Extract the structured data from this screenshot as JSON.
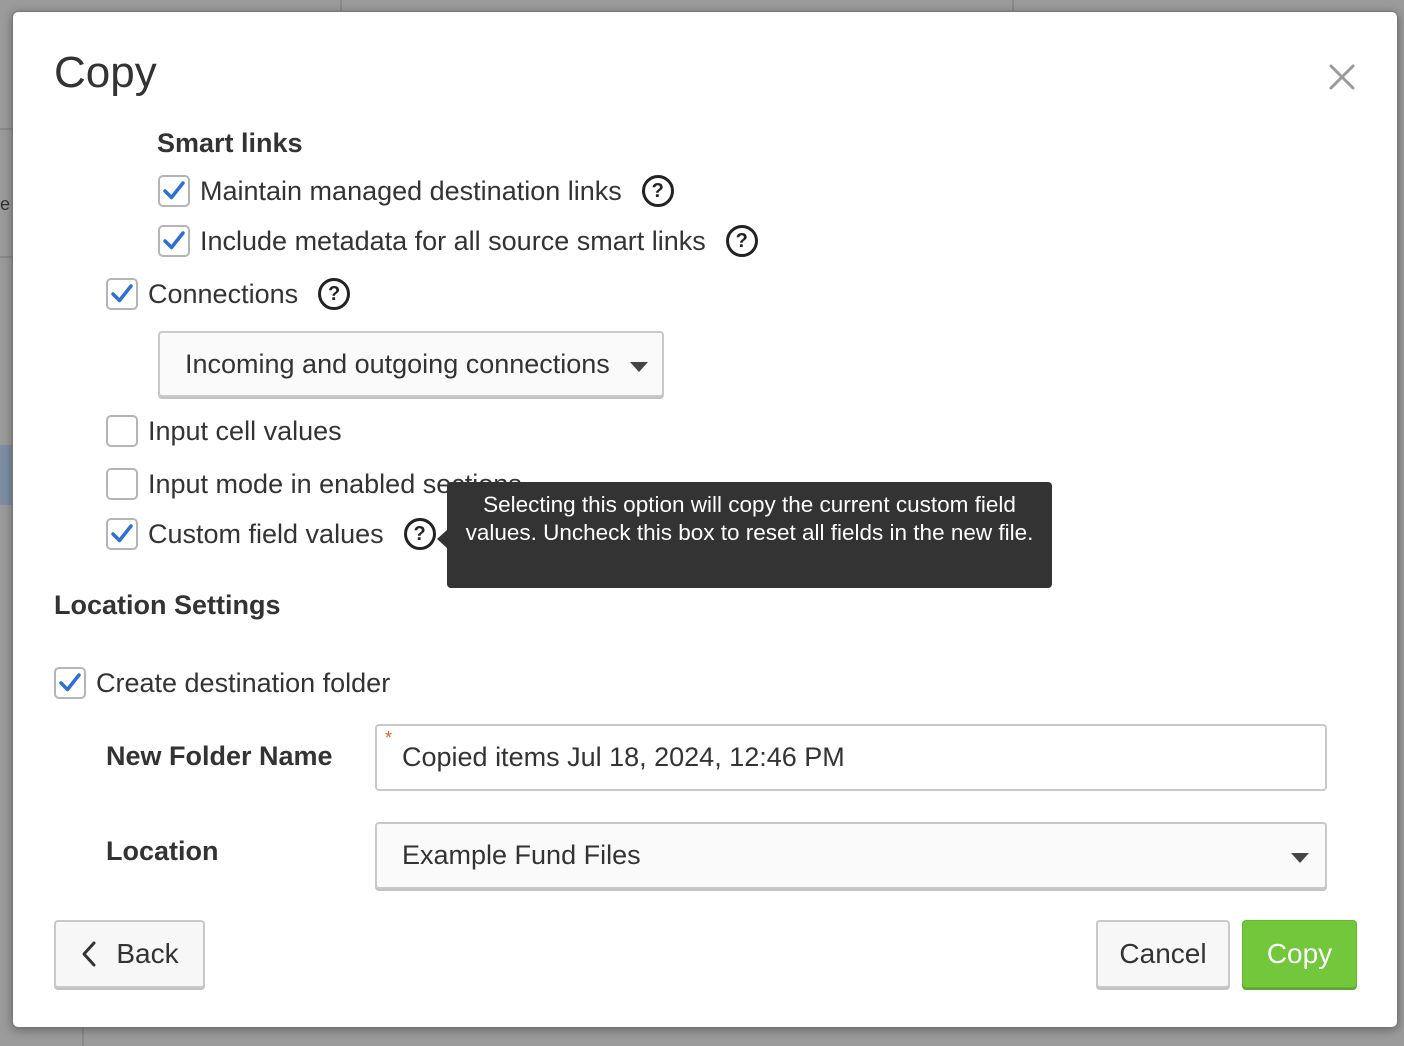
{
  "dialog": {
    "title": "Copy",
    "close_icon": "close-icon"
  },
  "background": {
    "fragment_text": "e"
  },
  "smart_links": {
    "heading": "Smart links",
    "items": [
      {
        "label": "Maintain managed destination links",
        "checked": true
      },
      {
        "label": "Include metadata for all source smart links",
        "checked": true
      }
    ]
  },
  "options": {
    "connections": {
      "label": "Connections",
      "checked": true
    },
    "connections_select": {
      "value": "Incoming and outgoing connections"
    },
    "input_cell_values": {
      "label": "Input cell values",
      "checked": false
    },
    "input_mode": {
      "label": "Input mode in enabled sections",
      "checked": false
    },
    "custom_field_values": {
      "label": "Custom field values",
      "checked": true
    }
  },
  "tooltip": {
    "text": "Selecting this option will copy the current custom field values. Uncheck this box to reset all fields in the new file."
  },
  "location_settings": {
    "heading": "Location Settings",
    "create_folder": {
      "label": "Create destination folder",
      "checked": true
    },
    "new_folder_name": {
      "label": "New Folder Name",
      "value": "Copied items Jul 18, 2024, 12:46 PM",
      "required_marker": "*"
    },
    "location": {
      "label": "Location",
      "value": "Example Fund Files"
    }
  },
  "footer": {
    "back_label": "Back",
    "cancel_label": "Cancel",
    "copy_label": "Copy"
  },
  "colors": {
    "check": "#2d6fd6",
    "primary": "#72c73a",
    "tooltip_bg": "#333333",
    "required": "#e0622b"
  },
  "help_icon": "question-circle-icon"
}
